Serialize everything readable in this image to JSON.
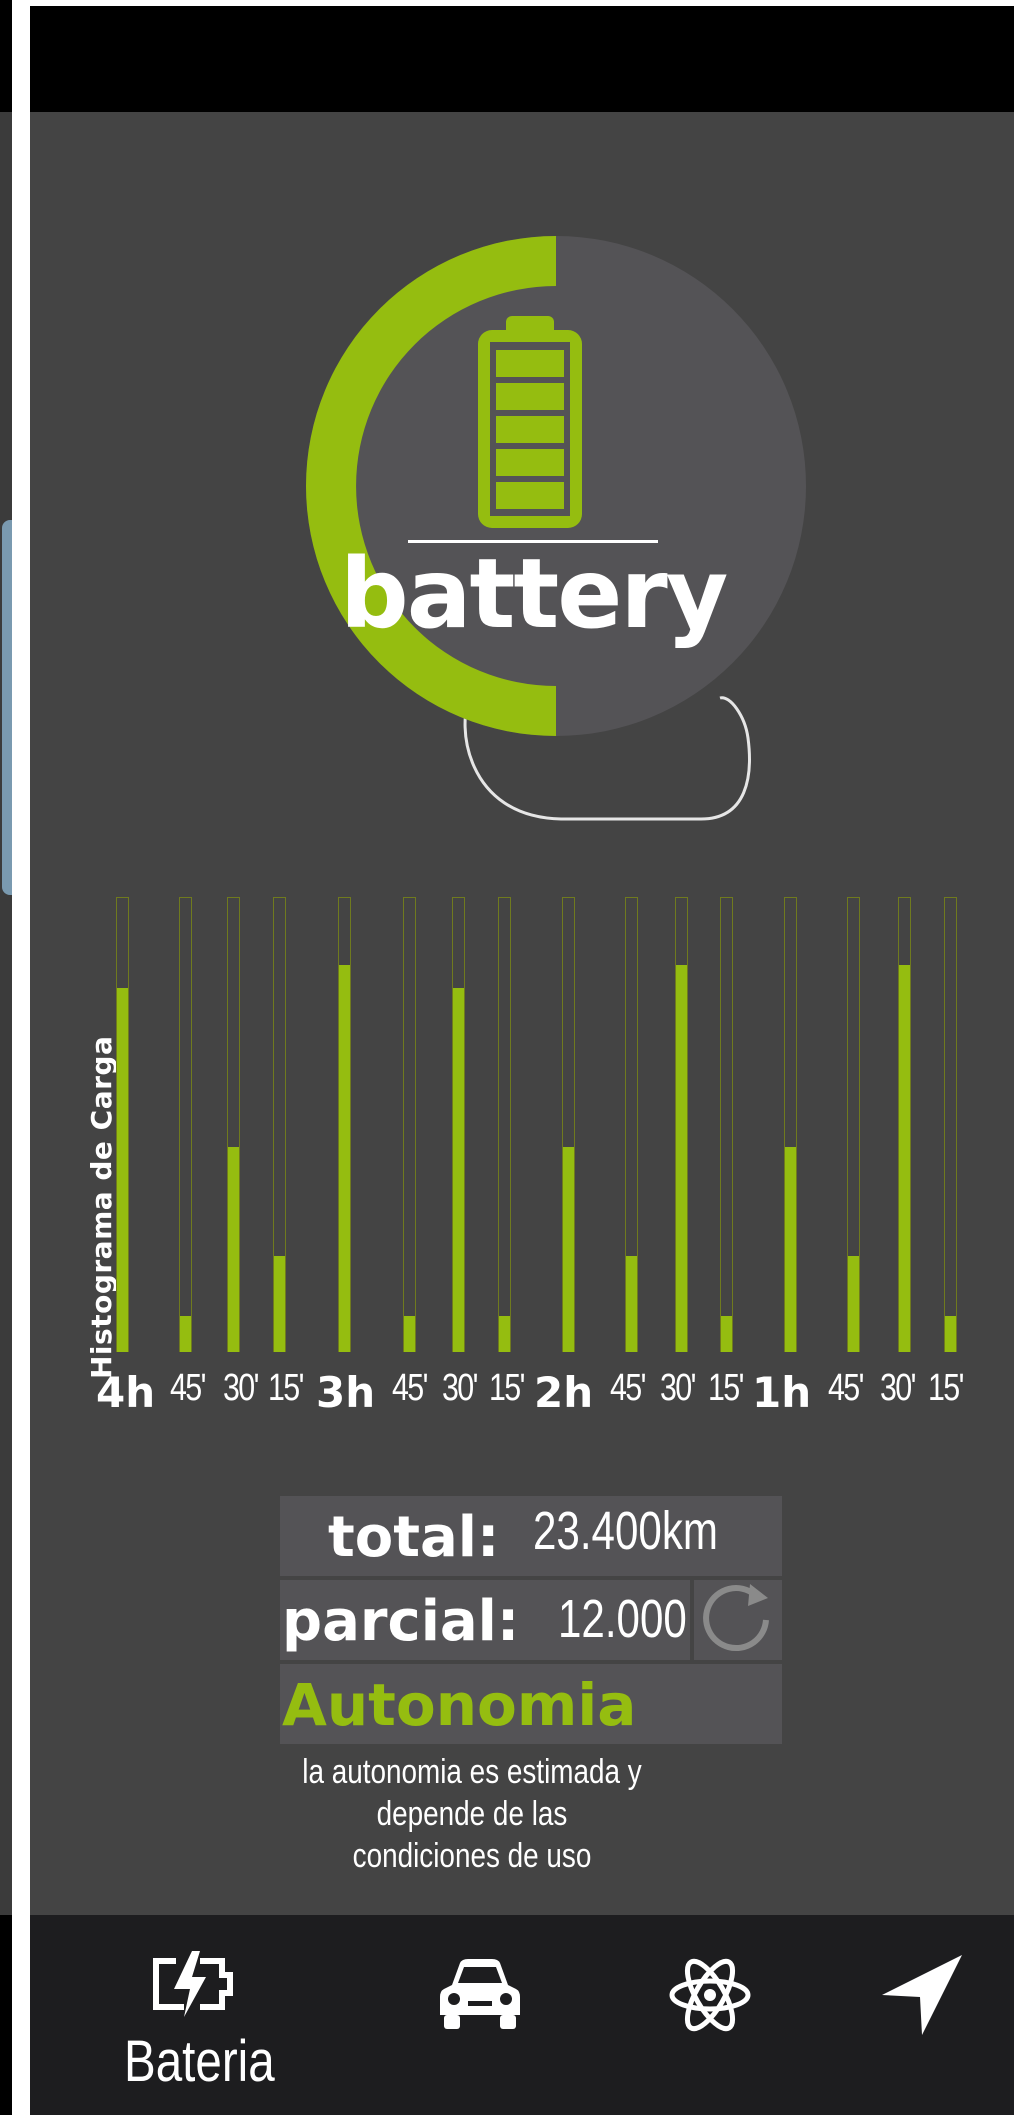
{
  "brand": {
    "accent": "#95bd10",
    "panel": "#444444",
    "box": "#545356",
    "nav_bg": "#1d1d1f"
  },
  "gauge": {
    "title": "battery",
    "charge_fraction": 0.5,
    "icon": "battery-full-icon"
  },
  "histogram": {
    "title": "Histograma de Carga",
    "ticks": [
      {
        "label": "4h",
        "kind": "hour"
      },
      {
        "label": "45'",
        "kind": "min"
      },
      {
        "label": "30'",
        "kind": "min"
      },
      {
        "label": "15'",
        "kind": "min"
      },
      {
        "label": "3h",
        "kind": "hour"
      },
      {
        "label": "45'",
        "kind": "min"
      },
      {
        "label": "30'",
        "kind": "min"
      },
      {
        "label": "15'",
        "kind": "min"
      },
      {
        "label": "2h",
        "kind": "hour"
      },
      {
        "label": "45'",
        "kind": "min"
      },
      {
        "label": "30'",
        "kind": "min"
      },
      {
        "label": "15'",
        "kind": "min"
      },
      {
        "label": "1h",
        "kind": "hour"
      },
      {
        "label": "45'",
        "kind": "min"
      },
      {
        "label": "30'",
        "kind": "min"
      },
      {
        "label": "15'",
        "kind": "min"
      }
    ]
  },
  "chart_data": {
    "type": "bar",
    "title": "Histograma de Carga",
    "categories": [
      "4h",
      "45'",
      "30'",
      "15'",
      "3h",
      "45'",
      "30'",
      "15'",
      "2h",
      "45'",
      "30'",
      "15'",
      "1h",
      "45'",
      "30'",
      "15'"
    ],
    "values": [
      0.8,
      0.08,
      0.45,
      0.21,
      0.85,
      0.08,
      0.8,
      0.08,
      0.45,
      0.21,
      0.85,
      0.08,
      0.45,
      0.21,
      0.85,
      0.08
    ],
    "ylim": [
      0,
      1
    ]
  },
  "stats": {
    "total_label": "total:",
    "total_value": "23.400km",
    "partial_label": "parcial:",
    "partial_value": "12.000",
    "autonomy_label": "Autonomia",
    "autonomy_value": "",
    "note_line1": "la autonomia es estimada y",
    "note_line2": "depende de las condiciones de uso"
  },
  "nav": {
    "items": [
      {
        "label": "Bateria",
        "icon": "battery-charging-icon"
      },
      {
        "label": "",
        "icon": "car-icon"
      },
      {
        "label": "",
        "icon": "atom-icon"
      },
      {
        "label": "",
        "icon": "navigation-arrow-icon"
      }
    ]
  }
}
